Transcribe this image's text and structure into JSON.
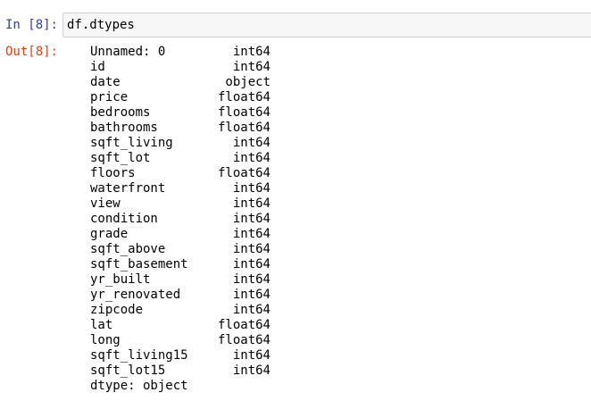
{
  "input": {
    "prompt": "In [8]:",
    "code": "df.dtypes"
  },
  "output": {
    "prompt": "Out[8]:",
    "rows": [
      {
        "name": "Unnamed: 0",
        "dtype": "int64"
      },
      {
        "name": "id",
        "dtype": "int64"
      },
      {
        "name": "date",
        "dtype": "object"
      },
      {
        "name": "price",
        "dtype": "float64"
      },
      {
        "name": "bedrooms",
        "dtype": "float64"
      },
      {
        "name": "bathrooms",
        "dtype": "float64"
      },
      {
        "name": "sqft_living",
        "dtype": "int64"
      },
      {
        "name": "sqft_lot",
        "dtype": "int64"
      },
      {
        "name": "floors",
        "dtype": "float64"
      },
      {
        "name": "waterfront",
        "dtype": "int64"
      },
      {
        "name": "view",
        "dtype": "int64"
      },
      {
        "name": "condition",
        "dtype": "int64"
      },
      {
        "name": "grade",
        "dtype": "int64"
      },
      {
        "name": "sqft_above",
        "dtype": "int64"
      },
      {
        "name": "sqft_basement",
        "dtype": "int64"
      },
      {
        "name": "yr_built",
        "dtype": "int64"
      },
      {
        "name": "yr_renovated",
        "dtype": "int64"
      },
      {
        "name": "zipcode",
        "dtype": "int64"
      },
      {
        "name": "lat",
        "dtype": "float64"
      },
      {
        "name": "long",
        "dtype": "float64"
      },
      {
        "name": "sqft_living15",
        "dtype": "int64"
      },
      {
        "name": "sqft_lot15",
        "dtype": "int64"
      }
    ],
    "footer": "dtype: object"
  },
  "colors": {
    "in_prompt": "#303f9f",
    "out_prompt": "#d84315",
    "input_bg": "#f7f7f7",
    "input_border": "#cfcfcf"
  }
}
